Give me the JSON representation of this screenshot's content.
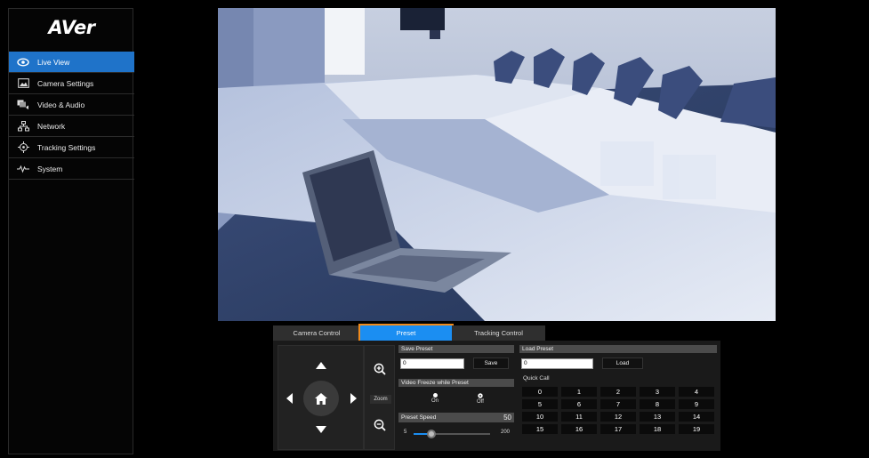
{
  "brand": {
    "logo_text": "AVer"
  },
  "sidebar": {
    "items": [
      {
        "label": "Live View",
        "icon": "eye-icon",
        "active": true
      },
      {
        "label": "Camera Settings",
        "icon": "image-icon",
        "active": false
      },
      {
        "label": "Video & Audio",
        "icon": "video-audio-icon",
        "active": false
      },
      {
        "label": "Network",
        "icon": "network-icon",
        "active": false
      },
      {
        "label": "Tracking Settings",
        "icon": "target-icon",
        "active": false
      },
      {
        "label": "System",
        "icon": "pulse-icon",
        "active": false
      }
    ]
  },
  "tabs": [
    {
      "label": "Camera Control",
      "active": false
    },
    {
      "label": "Preset",
      "active": true
    },
    {
      "label": "Tracking Control",
      "active": false
    }
  ],
  "controls": {
    "zoom_label": "Zoom"
  },
  "save_preset": {
    "heading": "Save Preset",
    "input_value": "0",
    "save_label": "Save"
  },
  "video_freeze": {
    "heading": "Video Freeze while Preset",
    "on_label": "On",
    "off_label": "Off"
  },
  "preset_speed": {
    "heading": "Preset Speed",
    "value": "50",
    "min_label": "5",
    "max_label": "200",
    "level": 0.23
  },
  "load_preset": {
    "heading": "Load Preset",
    "input_value": "0",
    "load_label": "Load"
  },
  "quick_call": {
    "heading": "Quick Call",
    "buttons": [
      "0",
      "1",
      "2",
      "3",
      "4",
      "5",
      "6",
      "7",
      "8",
      "9",
      "10",
      "11",
      "12",
      "13",
      "14",
      "15",
      "16",
      "17",
      "18",
      "19"
    ]
  },
  "colors": {
    "accent": "#1f73c9",
    "tab_active": "#1b8ef2",
    "highlight": "#f08a1c"
  }
}
